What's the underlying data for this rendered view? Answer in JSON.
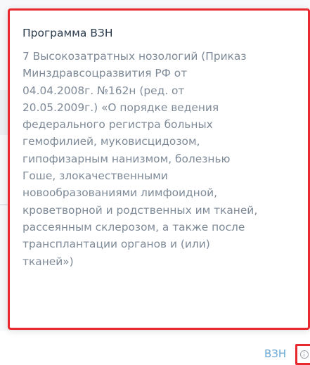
{
  "tooltip": {
    "title": "Программа ВЗН",
    "body": "7 Высокозатратных нозологий (Приказ\nМинздравсоцразвития РФ от\n04.04.2008г. №162н (ред. от\n20.05.2009г.) «О порядке ведения\nфедерального регистра больных\nгемофилией, муковисцидозом,\nгипофизарным нанизмом, болезнью\nГоше, злокачественными\nновообразованиями лимфоидной,\nкроветворной и родственных им тканей,\nрассеянным склерозом, а также после\nтрансплантации органов и (или)\nтканей»)"
  },
  "footer": {
    "link_label": "ВЗН",
    "icon": "info-icon"
  },
  "colors": {
    "highlight_border": "#e8292f",
    "title_text": "#2a3b4c",
    "body_text": "#7e8a97",
    "link": "#68a8d6"
  }
}
